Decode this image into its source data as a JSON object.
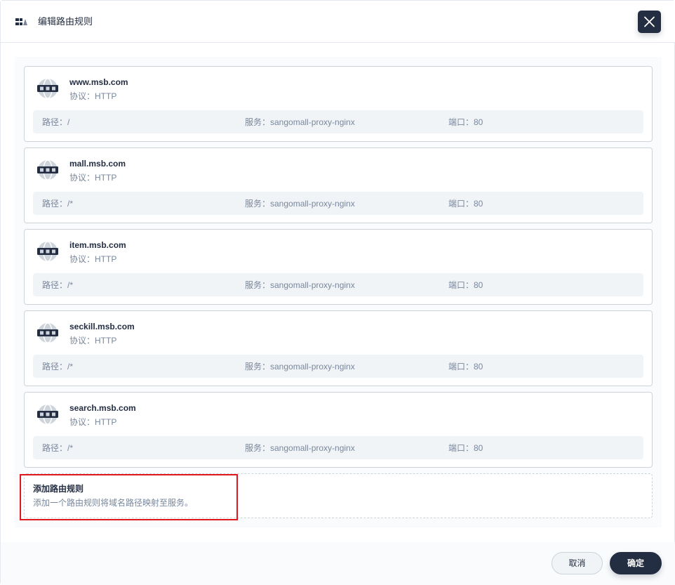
{
  "header": {
    "title": "编辑路由规则",
    "title_icon": "route-icon",
    "close_icon": "close-icon"
  },
  "rules": [
    {
      "host": "www.msb.com",
      "protocol": "协议：HTTP",
      "path": "路径：/",
      "service": "服务：sangomall-proxy-nginx",
      "port": "端口：80"
    },
    {
      "host": "mall.msb.com",
      "protocol": "协议：HTTP",
      "path": "路径：/*",
      "service": "服务：sangomall-proxy-nginx",
      "port": "端口：80"
    },
    {
      "host": "item.msb.com",
      "protocol": "协议：HTTP",
      "path": "路径：/*",
      "service": "服务：sangomall-proxy-nginx",
      "port": "端口：80"
    },
    {
      "host": "seckill.msb.com",
      "protocol": "协议：HTTP",
      "path": "路径：/*",
      "service": "服务：sangomall-proxy-nginx",
      "port": "端口：80"
    },
    {
      "host": "search.msb.com",
      "protocol": "协议：HTTP",
      "path": "路径：/*",
      "service": "服务：sangomall-proxy-nginx",
      "port": "端口：80"
    }
  ],
  "add_rule": {
    "title": "添加路由规则",
    "description": "添加一个路由规则将域名路径映射至服务。"
  },
  "footer": {
    "cancel_label": "取消",
    "ok_label": "确定"
  },
  "colors": {
    "primary_dark": "#242e42",
    "muted_text": "#79879c",
    "border": "#ccd3db",
    "row_bg": "#f1f4f7",
    "highlight": "#e0171f"
  }
}
